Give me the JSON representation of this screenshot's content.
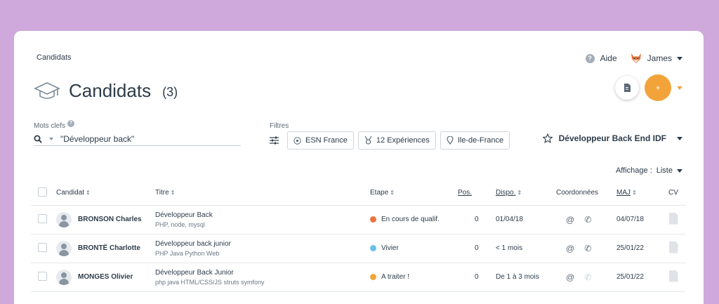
{
  "breadcrumb": "Candidats",
  "header": {
    "help_label": "Aide",
    "user_name": "James"
  },
  "page": {
    "title": "Candidats",
    "count": "(3)"
  },
  "actions": {
    "add_label": "+"
  },
  "search": {
    "label": "Mots clefs",
    "value": "\"Développeur back\""
  },
  "filters": {
    "label": "Filtres",
    "chips": [
      "ESN France",
      "12 Expériences",
      "Ile-de-France"
    ]
  },
  "saved_search": {
    "label": "Développeur Back End IDF"
  },
  "display": {
    "label": "Affichage :",
    "value": "Liste"
  },
  "table": {
    "headers": {
      "candidate": "Candidat",
      "title": "Titre",
      "stage": "Etape",
      "pos": "Pos.",
      "availability": "Dispo.",
      "contact": "Coordonnées",
      "updated": "MAJ",
      "cv": "CV"
    },
    "rows": [
      {
        "name": "BRONSON Charles",
        "title": "Développeur Back",
        "skills": "PHP, node, mysql",
        "stage": "En cours de qualif.",
        "stage_color": "#e8743b",
        "pos": "0",
        "availability": "01/04/18",
        "updated": "04/07/18",
        "phone_active": true
      },
      {
        "name": "BRONTË Charlotte",
        "title": "Développeur back junior",
        "skills": "PHP Java Python Web",
        "stage": "Vivier",
        "stage_color": "#6cc0e8",
        "pos": "0",
        "availability": "< 1 mois",
        "updated": "25/01/22",
        "phone_active": true
      },
      {
        "name": "MONGES Olivier",
        "title": "Développeur Back Junior",
        "skills": "php java HTML/CSS/JS struts symfony",
        "stage": "A traiter !",
        "stage_color": "#f2a33a",
        "pos": "0",
        "availability": "De 1 à 3 mois",
        "updated": "25/01/22",
        "phone_active": false
      }
    ]
  },
  "colors": {
    "accent": "#f2a33a",
    "background": "#cfa8dc",
    "text": "#2d3b4a"
  },
  "icons": [
    "graduation-cap-icon",
    "question-icon",
    "fox-avatar-icon",
    "document-icon",
    "search-icon",
    "filter-sliders-icon",
    "building-icon",
    "medal-icon",
    "location-icon",
    "star-icon",
    "at-icon",
    "phone-icon",
    "cv-document-icon",
    "person-icon"
  ]
}
